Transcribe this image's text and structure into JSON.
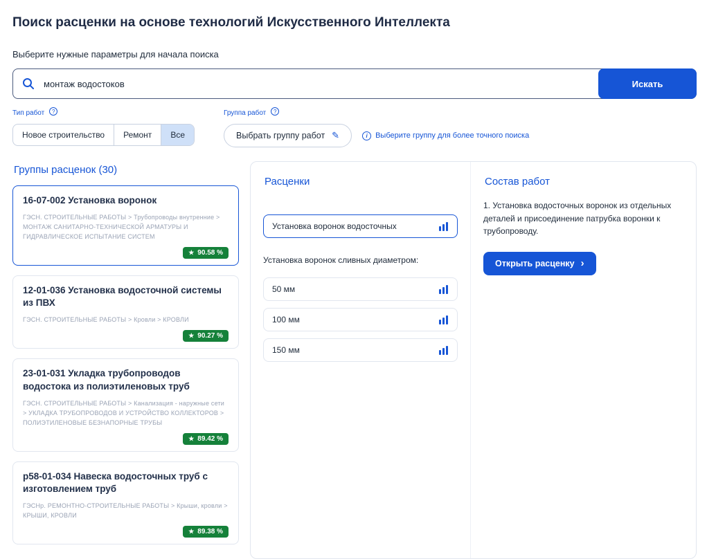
{
  "page": {
    "title": "Поиск расценки на основе технологий Искусственного Интеллекта",
    "subtitle": "Выберите нужные параметры для начала поиска"
  },
  "search": {
    "value": "монтаж водостоков",
    "button_label": "Искать"
  },
  "filters": {
    "type_label": "Тип работ",
    "group_label": "Группа работ",
    "segments": [
      "Новое строительство",
      "Ремонт",
      "Все"
    ],
    "selected_segment": "Все",
    "group_button_label": "Выбрать группу работ",
    "group_hint": "Выберите группу для более точного поиска"
  },
  "groups": {
    "heading": "Группы расценок (30)",
    "items": [
      {
        "title": "16-07-002 Установка воронок",
        "path": "ГЭСН. СТРОИТЕЛЬНЫЕ РАБОТЫ > Трубопроводы внутренние > МОНТАЖ САНИТАРНО-ТЕХНИЧЕСКОЙ АРМАТУРЫ И ГИДРАВЛИЧЕСКОЕ ИСПЫТАНИЕ СИСТЕМ",
        "match": "90.58 %"
      },
      {
        "title": "12-01-036 Установка водосточной системы из ПВХ",
        "path": "ГЭСН. СТРОИТЕЛЬНЫЕ РАБОТЫ > Кровли > КРОВЛИ",
        "match": "90.27 %"
      },
      {
        "title": "23-01-031 Укладка трубопроводов водостока из полиэтиленовых труб",
        "path": "ГЭСН. СТРОИТЕЛЬНЫЕ РАБОТЫ > Канализация - наружные сети > УКЛАДКА ТРУБОПРОВОДОВ И УСТРОЙСТВО КОЛЛЕКТОРОВ > ПОЛИЭТИЛЕНОВЫЕ БЕЗНАПОРНЫЕ ТРУБЫ",
        "match": "89.42 %"
      },
      {
        "title": "р58-01-034 Навеска водосточных труб с изготовлением труб",
        "path": "ГЭСНр. РЕМОНТНО-СТРОИТЕЛЬНЫЕ РАБОТЫ > Крыши, кровли > КРЫШИ, КРОВЛИ",
        "match": "89.38 %"
      }
    ]
  },
  "rates": {
    "heading": "Расценки",
    "selected": "Установка воронок водосточных",
    "subheading": "Установка воронок сливных диаметром:",
    "options": [
      "50 мм",
      "100 мм",
      "150 мм"
    ]
  },
  "composition": {
    "heading": "Состав работ",
    "text": "1. Установка водосточных воронок из отдельных деталей и присоединение патрубка воронки к трубопроводу.",
    "button_label": "Открыть расценку"
  },
  "icons": {
    "star": "★",
    "pencil": "✎",
    "chevron_right": "›",
    "question": "?",
    "info": "i"
  },
  "colors": {
    "accent": "#1655d6",
    "badge_green": "#15813a",
    "segment_selected_bg": "#cfe0f8",
    "card_border": "#e1e6ef"
  }
}
